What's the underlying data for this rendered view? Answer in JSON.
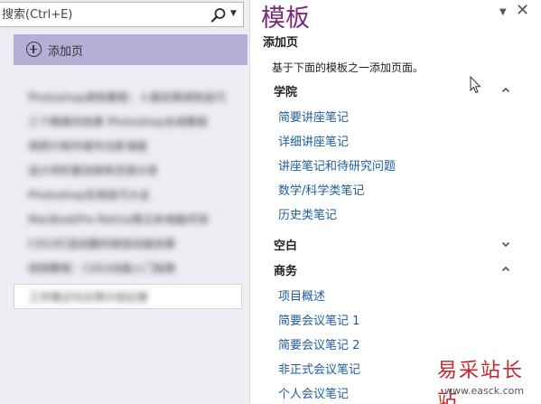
{
  "search": {
    "placeholder": "搜索(Ctrl+E)"
  },
  "left": {
    "add_page_label": "添加页",
    "pages": [
      "Photoshop调色教程：人像后期调色技巧",
      "三个精美的效果 Photoshop合成教程",
      "用照片制作城市光影海报",
      "设计师的素材库和灵感分享",
      "Photoshop实用技巧大全",
      "MacBookPro Retina笔记本电脑评测",
      "CSS3打造炫酷的按钮动画效果",
      "视频教程：CSS3动画入门指南"
    ],
    "selected_page": "工作笔记与日常计划记录"
  },
  "pane": {
    "title": "模板",
    "subtitle": "添加页",
    "description": "基于下面的模板之一添加页面。",
    "dropdown_glyph": "▼",
    "close_glyph": "✕"
  },
  "categories": {
    "academic": {
      "label": "学院",
      "chevron": "^",
      "items": [
        "简要讲座笔记",
        "详细讲座笔记",
        "讲座笔记和待研究问题",
        "数学/科学类笔记",
        "历史类笔记"
      ]
    },
    "blank": {
      "label": "空白",
      "chevron": "v"
    },
    "business": {
      "label": "商务",
      "chevron": "^",
      "items": [
        "项目概述",
        "简要会议笔记 1",
        "简要会议笔记 2",
        "非正式会议笔记",
        "个人会议笔记"
      ]
    }
  },
  "watermark": {
    "text": "易采站长站",
    "url": "www.easck.com"
  },
  "colors": {
    "accent_title": "#7b2a7e",
    "link": "#1f5c9e",
    "add_page_bg": "#b6aed6",
    "left_bg": "#efedf3"
  }
}
